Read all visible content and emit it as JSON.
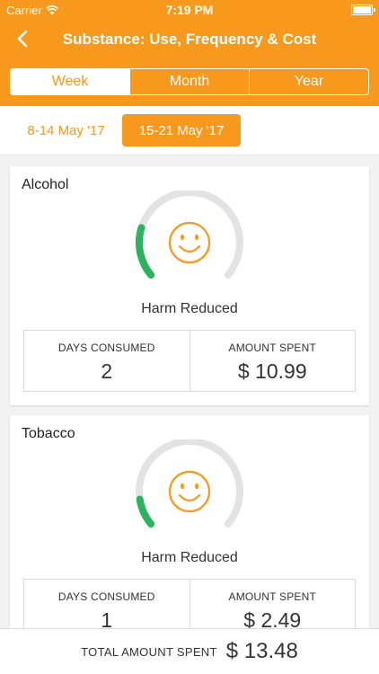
{
  "status_bar": {
    "carrier": "Carrier",
    "time": "7:19 PM"
  },
  "nav": {
    "title": "Substance: Use, Frequency & Cost",
    "back_icon": "chevron-left-icon"
  },
  "segments": [
    {
      "label": "Week",
      "active": true
    },
    {
      "label": "Month",
      "active": false
    },
    {
      "label": "Year",
      "active": false
    }
  ],
  "weeks": [
    {
      "label": "8-14 May '17",
      "active": false
    },
    {
      "label": "15-21 May '17",
      "active": true
    }
  ],
  "cards": [
    {
      "name": "Alcohol",
      "gauge_label": "Harm Reduced",
      "gauge_fraction": 0.22,
      "days_label": "DAYS CONSUMED",
      "days_value": "2",
      "amount_label": "AMOUNT SPENT",
      "amount_value": "$ 10.99"
    },
    {
      "name": "Tobacco",
      "gauge_label": "Harm Reduced",
      "gauge_fraction": 0.12,
      "days_label": "DAYS CONSUMED",
      "days_value": "1",
      "amount_label": "AMOUNT SPENT",
      "amount_value": "$ 2.49"
    }
  ],
  "footer": {
    "label": "TOTAL AMOUNT SPENT",
    "value": "$ 13.48"
  },
  "colors": {
    "accent": "#f7991c",
    "gauge_progress": "#2db35d",
    "gauge_track": "#e3e3e3",
    "smiley": "#f7991c"
  }
}
